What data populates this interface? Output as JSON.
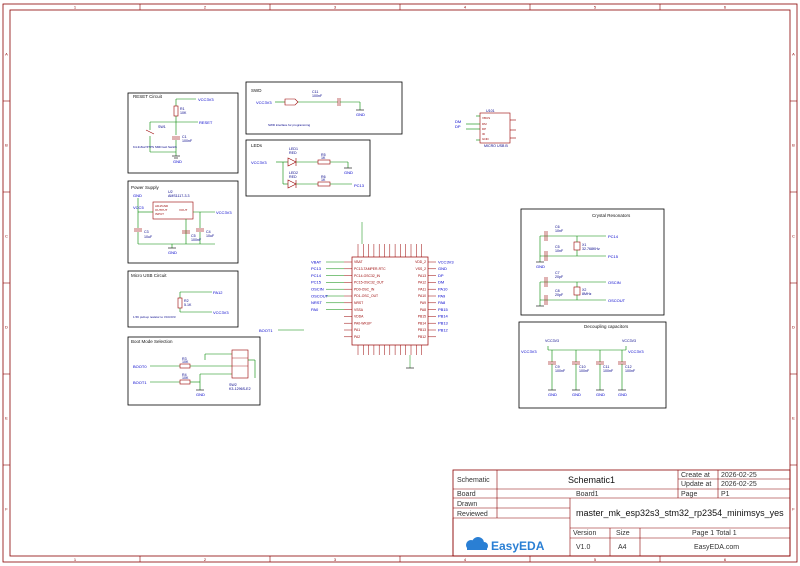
{
  "frame": {
    "col_labels": [
      "1",
      "2",
      "3",
      "4",
      "5",
      "6"
    ],
    "row_labels": [
      "A",
      "B",
      "C",
      "D",
      "E",
      "F"
    ]
  },
  "blocks": {
    "reset": {
      "title": "RESET Circuit",
      "parts": [
        "R1",
        "10K",
        "C1",
        "100nF",
        "SW1"
      ],
      "nets": [
        "VCC3V3",
        "RESET",
        "GND"
      ],
      "note": "K4-3x6x2.5TPS SMD tact Switch"
    },
    "power": {
      "title": "Power Supply",
      "parts": [
        "U2",
        "AMS1117-3.3",
        "C3",
        "10uF",
        "C5",
        "100nF",
        "C4",
        "10uF"
      ],
      "chip_pins": [
        "ADJ/GND",
        "OUTPUT",
        "VOUT",
        "INPUT"
      ],
      "nets": [
        "GND",
        "VCC5",
        "VCC3V3"
      ]
    },
    "usb": {
      "title": "Micro USB Circuit",
      "parts": [
        "R2",
        "5.1K"
      ],
      "nets": [
        "PA12",
        "VCC3V3"
      ],
      "note": "1.5K pull-up resistor to VCC3V3"
    },
    "boot": {
      "title": "Boot Mode Selection",
      "parts": [
        "R3",
        "10K",
        "R4",
        "10K",
        "SW2",
        "K3-1296S-E2"
      ],
      "nets": [
        "BOOT0",
        "BOOT1",
        "GND"
      ]
    },
    "swd": {
      "title": "SWD",
      "parts": [
        "C11",
        "100nF"
      ],
      "nets": [
        "VCC3V3",
        "GND"
      ],
      "note": "SWD interface for programming"
    },
    "leds": {
      "title": "LEDs",
      "parts": [
        "LED1",
        "LED2",
        "R5",
        "1K",
        "R6",
        "1K",
        "RED"
      ],
      "nets": [
        "VCC3V3",
        "GND",
        "PC13"
      ]
    },
    "usbconn": {
      "ref": "U101",
      "name": "MICRO USB B",
      "nets": [
        "VBUS",
        "DM",
        "DP",
        "ID",
        "GND"
      ]
    },
    "mcu": {
      "nets_left": [
        "VBAT",
        "PC13",
        "PC14",
        "PC15",
        "OSCIN",
        "OSCOUT",
        "NRST",
        "PA0"
      ],
      "pins_left": [
        "VBAT",
        "PC13-TAMPER-RTC",
        "PC14-OSC32_IN",
        "PC15-OSC32_OUT",
        "PD0-OSC_IN",
        "PD1-OSC_OUT",
        "NRST",
        "VSSA",
        "VDDA",
        "PA0-WKUP",
        "PA1",
        "PA2"
      ],
      "nets_right": [
        "VCC3V3",
        "GND",
        "DP",
        "DM",
        "PA10",
        "PA9",
        "PA8",
        "PB15",
        "PB14",
        "PB13",
        "PB12"
      ],
      "pins_right": [
        "VDD_2",
        "VSS_2",
        "PA13",
        "PA12",
        "PA11",
        "PA10",
        "PA9",
        "PA8",
        "PB15",
        "PB14",
        "PB13",
        "PB12"
      ]
    },
    "crystal": {
      "title": "Crystal Resonators",
      "parts": [
        "C6",
        "10nF",
        "C5",
        "10nF",
        "X1",
        "32.768KHz",
        "C7",
        "20pF",
        "C8",
        "20pF",
        "X2",
        "8MHz"
      ],
      "nets": [
        "PC14",
        "PC15",
        "OSCIN",
        "OSCOUT",
        "GND"
      ]
    },
    "decoupling": {
      "title": "Decoupling capacitors",
      "parts": [
        "C9",
        "100nF",
        "C10",
        "100nF",
        "C11",
        "100nF",
        "C12",
        "100nF"
      ],
      "nets": [
        "VCC3V3",
        "VCC3V3",
        "GND"
      ]
    },
    "boot1_label": "BOOT1"
  },
  "title_block": {
    "schematic_label": "Schematic",
    "schematic_value": "Schematic1",
    "create_label": "Create at",
    "create_value": "2026-02-25",
    "update_label": "Update at",
    "update_value": "2026-02-25",
    "board_label": "Board",
    "board_value": "Board1",
    "page_label": "Page",
    "page_value": "P1",
    "drawn_label": "Drawn",
    "reviewed_label": "Reviewed",
    "project_name": "master_mk_esp32s3_stm32_rp2354_minimsys_yes",
    "version_label": "Version",
    "version_value": "V1.0",
    "size_label": "Size",
    "size_value": "A4",
    "page_count": "Page  1  Total  1",
    "site": "EasyEDA.com",
    "logo_text": "EasyEDA"
  },
  "colors": {
    "frame": "#8b0000",
    "wire": "#008800",
    "net_label": "#0000cc",
    "part": "#990000",
    "logo": "#2a7fd4"
  }
}
